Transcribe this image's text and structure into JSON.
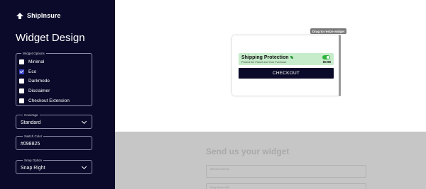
{
  "brand": {
    "name": "ShipInsure",
    "logo_icon": "shipinsure-logo-icon"
  },
  "sidebar": {
    "title": "Widget Design",
    "widget_options": {
      "legend": "Widget Options",
      "items": [
        {
          "label": "Minimal",
          "checked": false
        },
        {
          "label": "Eco",
          "checked": true
        },
        {
          "label": "Darkmode",
          "checked": false
        },
        {
          "label": "Disclaimer",
          "checked": false
        },
        {
          "label": "Checkout Extension",
          "checked": false
        }
      ]
    },
    "coverage": {
      "legend": "Coverage",
      "value": "Standard"
    },
    "switch_color": {
      "legend": "Switch Color",
      "value": "#098825"
    },
    "snap_option": {
      "legend": "Snap Option",
      "value": "Snap Right"
    }
  },
  "preview": {
    "drag_tip": "Drag to resize widget",
    "protection_title": "Shipping Protection",
    "protection_subtitle": "Protect the Planet and Your Purchase",
    "price": "$0.98",
    "checkout_label": "CHECKOUT",
    "toggle_on": true,
    "colors": {
      "sidebar_bg": "#0b0a2a",
      "protection_bg": "#c7eccb",
      "toggle": "#2db43b",
      "checkbox_checked": "#3b46c9"
    }
  },
  "send": {
    "title": "Send us your widget",
    "fields": [
      {
        "placeholder": "Merchant Email"
      },
      {
        "placeholder": "Shop Store URL"
      }
    ]
  }
}
